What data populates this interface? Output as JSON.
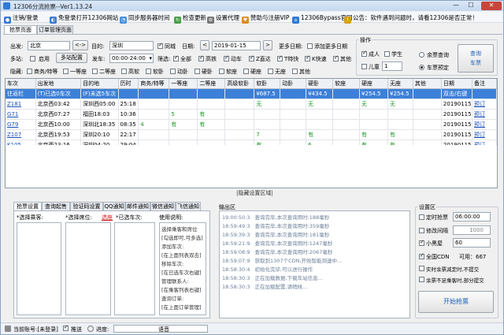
{
  "window": {
    "title": "12306分流抢票--Ver1.13.24"
  },
  "menu": {
    "items": [
      "注销/登录",
      "免登录打开12306网站",
      "同步服务器时间",
      "检查更新",
      "设置代理",
      "赞助与注册VIP",
      "12306Bypass官网",
      "公告：软件遇到问题时，请看12306是否正常！"
    ]
  },
  "tabs": {
    "main": [
      "抢票页面",
      "订单管理页面"
    ]
  },
  "query": {
    "from_label": "出发:",
    "from_value": "北京",
    "swap_label": "<->",
    "to_label": "目的:",
    "to_value": "深圳",
    "same_city_label": "同城",
    "date_label": "日期:",
    "prev": "<",
    "date_value": "2019-01-15",
    "next": ">",
    "more_dates_label": "更多日期:",
    "add_more_dates": "添加更多日期",
    "multi_label": "多站:",
    "enable_label": "启用",
    "add_station_btn": "多站配置",
    "depart_label": "发车:",
    "depart_value": "00:00-24:00",
    "filter_label": "筛选:",
    "filters": [
      "全部",
      "高铁",
      "动车",
      "Z直达",
      "T特快",
      "K快速",
      "其他"
    ],
    "hide_label": "隐藏:",
    "hide_items": [
      "商务/特等",
      "一等座",
      "二等座",
      "高软",
      "软卧",
      "动卧",
      "硬卧",
      "软座",
      "硬座",
      "无座",
      "其他"
    ]
  },
  "ops": {
    "title": "操作",
    "adult": "成人",
    "student": "学生",
    "child": "儿童",
    "child_count": "1",
    "remain_query": "余票查询",
    "car_reserve": "车票预定",
    "query_btn": "查询\n车票"
  },
  "grid": {
    "headers": [
      "车次",
      "出发地",
      "目的地",
      "历时",
      "商务/特等",
      "一等座",
      "二等座",
      "高级软卧",
      "软卧",
      "动卧",
      "硬卧",
      "软座",
      "硬座",
      "无座",
      "其他",
      "日期",
      "备注"
    ],
    "rows": [
      [
        "往返栏",
        "(T)已选0车次",
        "(F)未选5车次",
        "",
        "",
        "",
        "",
        "",
        "¥687.5",
        "",
        "¥434.5",
        "",
        "¥254.5",
        "¥254.5",
        "",
        "双击/右键",
        ""
      ],
      [
        "Z181",
        "北京西03:42",
        "深圳西05:00",
        "25:18",
        "",
        "",
        "",
        "",
        "无",
        "",
        "无",
        "",
        "无",
        "无",
        "",
        "20190115",
        "预订"
      ],
      [
        "G71",
        "北京西07:27",
        "福田18:03",
        "10:36",
        "",
        "5",
        "有",
        "",
        "",
        "",
        "",
        "",
        "",
        "",
        "",
        "20190115",
        "预订"
      ],
      [
        "G79",
        "北京西10:00",
        "深圳北18:35",
        "08:35",
        "4",
        "有",
        "有",
        "",
        "",
        "",
        "",
        "",
        "",
        "",
        "",
        "20190115",
        "预订"
      ],
      [
        "Z107",
        "北京西19:53",
        "深圳20:10",
        "22:17",
        "",
        "",
        "",
        "",
        "7",
        "",
        "有",
        "",
        "有",
        "有",
        "",
        "20190115",
        "预订"
      ],
      [
        "K105",
        "北京西23:16",
        "深圳04:20",
        "29:04",
        "",
        "",
        "",
        "",
        "有",
        "",
        "6",
        "",
        "有",
        "有",
        "",
        "20190115",
        "预订"
      ]
    ],
    "footer": "|隐藏设置区域|"
  },
  "bottom_tabs": [
    "抢票设置",
    "查询起售",
    "验证码设置",
    "QQ通知",
    "邮件通知",
    "微信通知",
    "飞信通知"
  ],
  "passenger": {
    "label": "*选择乘客:",
    "seat_label": "*选择席位:",
    "seat_value": "选座",
    "train_label": "*已选车次:"
  },
  "help": {
    "title": "使用说明:",
    "lines": [
      "选择乘客和席位",
      "[勾选即可,可多选]",
      "添加车次:",
      "[在上面列表双击]",
      "移除车次:",
      "[在已选车次右键]",
      "管理联系人:",
      "[在乘客列表右键]",
      "查询订单:",
      "[在上面订单管理]"
    ]
  },
  "output": {
    "title": "输出区",
    "lines": [
      [
        "19:00:50:3",
        "查询完毕,本次查询用时:188毫秒"
      ],
      [
        "18:59:49:3",
        "查询完毕,本次查询用时:359毫秒"
      ],
      [
        "18:59:39:3",
        "查询完毕,本次查询用时:181毫秒"
      ],
      [
        "18:59:21:9",
        "查询完毕,本次查询用时:1247毫秒"
      ],
      [
        "18:59:08:9",
        "查询完毕,本次查询用时:2067毫秒"
      ],
      [
        "18:59:07:9",
        "获取到1307个CDN,开始智能测速中..."
      ],
      [
        "18:58:30:4",
        "初始化完毕,可以进行操作"
      ],
      [
        "18:58:30:3",
        "正在加载数据,下载车站信息..."
      ],
      [
        "18:58:30:3",
        "正在加载配置,请稍候..."
      ]
    ]
  },
  "settings": {
    "title": "设置区",
    "timed": "定时抢票",
    "timed_value": "06:00:00",
    "interval": "修改间隔",
    "interval_value": "1000",
    "black": "小黑屋",
    "black_value": "60",
    "cdn": "全国CDN",
    "cdn_avail": "可用：667",
    "realtime": "实时余票减定时,不提交",
    "partial": "余票不足乘客时,部分提交",
    "start_btn": "开始抢票"
  },
  "status": {
    "account": "当前账号:[未登录]",
    "push": "推送",
    "progress": "进度:",
    "voice": "语音"
  }
}
